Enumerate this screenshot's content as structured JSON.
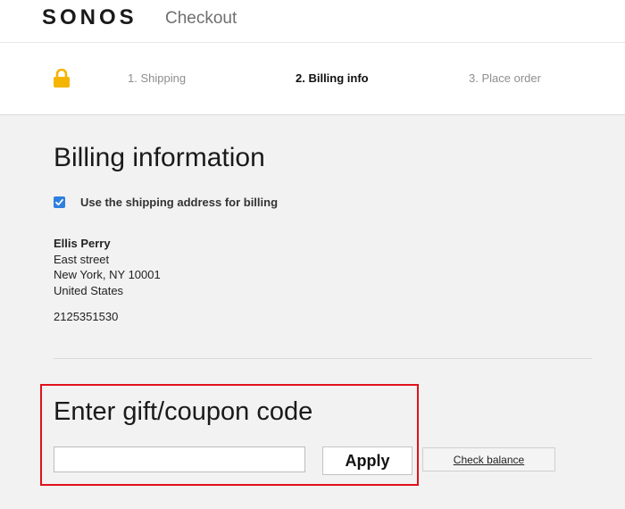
{
  "header": {
    "logo": "SONOS",
    "title": "Checkout"
  },
  "steps": [
    {
      "label": "1. Shipping",
      "active": false
    },
    {
      "label": "2. Billing info",
      "active": true
    },
    {
      "label": "3. Place order",
      "active": false
    }
  ],
  "billing": {
    "heading": "Billing information",
    "use_shipping_label": "Use the shipping address for billing",
    "use_shipping_checked": true,
    "address": {
      "name": "Ellis Perry",
      "street": "East street",
      "city_line": "New York, NY 10001",
      "country": "United States"
    },
    "phone": "2125351530"
  },
  "coupon": {
    "heading": "Enter gift/coupon code",
    "input_value": "",
    "apply_label": "Apply",
    "check_balance_label": "Check balance"
  },
  "colors": {
    "lock": "#f5b400",
    "checkbox": "#2f7fdf",
    "highlight_border": "#e0121b"
  }
}
